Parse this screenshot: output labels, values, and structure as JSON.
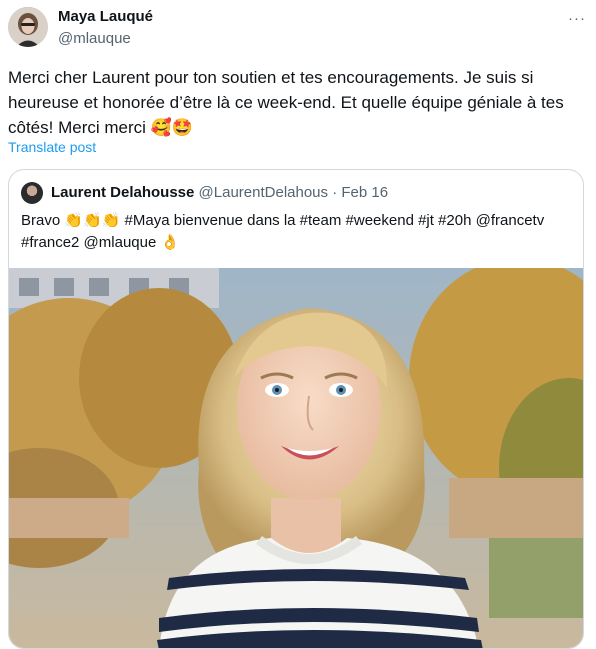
{
  "tweet": {
    "author_name": "Maya Lauqué",
    "author_handle": "@mlauque",
    "more_glyph": "···",
    "text": "Merci cher Laurent pour ton soutien et tes encouragements. Je suis si heureuse et honorée d’être là ce week-end. Et quelle équipe géniale à tes côtés! Merci merci 🥰🤩",
    "translate_label": "Translate post"
  },
  "quoted": {
    "author_name": "Laurent Delahousse",
    "author_handle": "@LaurentDelahous",
    "separator": "·",
    "date": "Feb 16",
    "text": "Bravo 👏👏👏 #Maya bienvenue dans la #team #weekend #jt #20h @francetv #france2 @mlauque 👌"
  },
  "colors": {
    "text": "#0f1419",
    "secondary": "#536471",
    "link": "#1d9bf0",
    "border": "#cfd9de"
  }
}
